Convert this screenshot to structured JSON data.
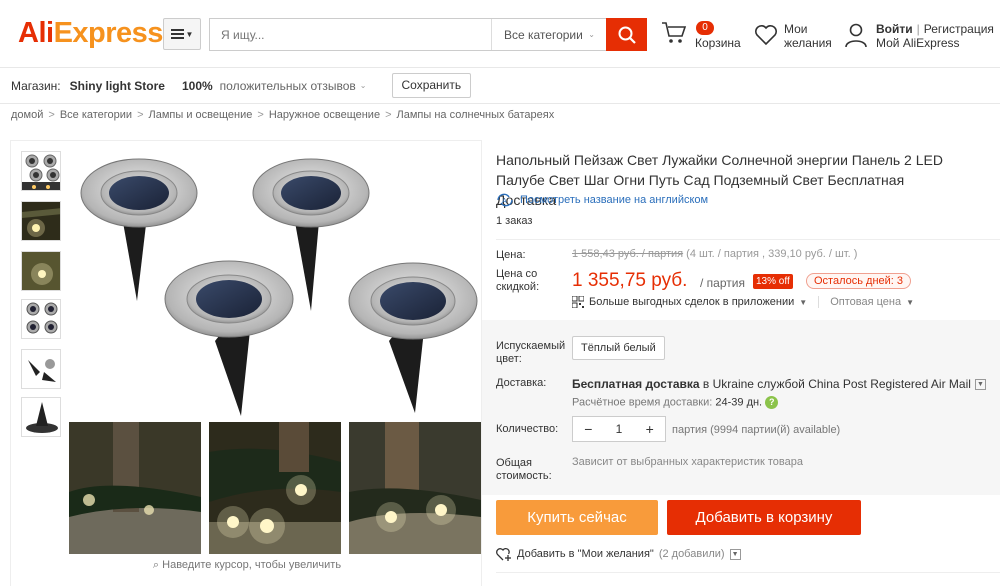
{
  "header": {
    "logo_a": "Ali",
    "logo_b": "Express",
    "search_placeholder": "Я ищу...",
    "category": "Все категории",
    "cart_count": "0",
    "cart_label": "Корзина",
    "wish_line1": "Мои",
    "wish_line2": "желания",
    "login": "Войти",
    "register": "Регистрация",
    "my_ali": "Мой AliExpress"
  },
  "store": {
    "label": "Магазин:",
    "name": "Shiny light Store",
    "positive_pct": "100%",
    "positive_text": "положительных отзывов",
    "save": "Сохранить"
  },
  "breadcrumb": [
    "домой",
    "Все категории",
    "Лампы и освещение",
    "Наружное освещение",
    "Лампы на солнечных батареях"
  ],
  "gallery": {
    "zoom_hint": "Наведите курсор, чтобы увеличить"
  },
  "product": {
    "title": "Напольный Пейзаж Свет Лужайки Солнечной энергии Панель 2 LED Палубе Свет Шаг Огни Путь Сад Подземный Свет Бесплатная Доставка",
    "translate": "Посмотреть название на английском",
    "orders": "1 заказ",
    "price_label": "Цена:",
    "old_price": "1 558,43 руб. / партия",
    "old_price_note": "(4 шт. / партия , 339,10 руб. / шт. )",
    "sale_label": "Цена со скидкой:",
    "sale_price": "1 355,75 руб.",
    "per_lot": "/ партия",
    "discount": "13% off",
    "days_left": "Осталось дней: 3",
    "app_deals": "Больше выгодных сделок в приложении",
    "wholesale": "Оптовая цена",
    "color_label": "Испускаемый цвет:",
    "color_value": "Тёплый белый",
    "shipping_label": "Доставка:",
    "shipping_free": "Бесплатная доставка",
    "shipping_rest": " в Ukraine службой China Post Registered Air Mail",
    "delivery_label": "Расчётное время доставки:",
    "delivery_value": "24-39 дн.",
    "qty_label": "Количество:",
    "qty_minus": "−",
    "qty_value": "1",
    "qty_plus": "+",
    "available": "партия (9994 партии(й) available)",
    "total_label": "Общая стоимость:",
    "total_value": "Зависит от выбранных характеристик товара",
    "buy_now": "Купить сейчас",
    "add_cart": "Добавить в корзину",
    "add_wish": "Добавить в \"Мои желания\"",
    "wish_count": "(2 добавили)"
  }
}
